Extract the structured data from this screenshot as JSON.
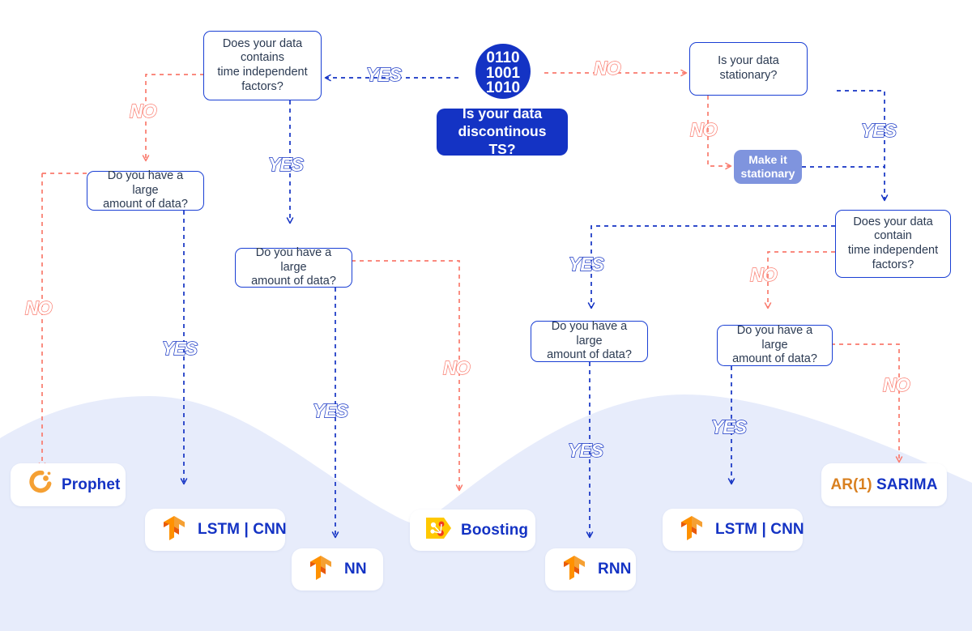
{
  "diagram": {
    "title": "Time series model selection flowchart",
    "colors": {
      "blue": "#1433c4",
      "coral": "#fa7a6d",
      "periwinkle": "#7f94de",
      "wave": "#e7ecfb",
      "orange": "#f5a033",
      "yellow": "#ffc801",
      "text": "#2b3a52"
    },
    "root": {
      "icon": "binary-circle-icon",
      "icon_rows": [
        "0110",
        "1001",
        "1010"
      ],
      "label": "Is your data\ndiscontinous TS?"
    },
    "decisions": [
      {
        "id": "d-left-factors",
        "label": "Does your data\ncontains\ntime independent\nfactors?"
      },
      {
        "id": "d-stationary",
        "label": "Is your data\nstationary?"
      },
      {
        "id": "d-right-factors",
        "label": "Does your data\ncontain\ntime independent\nfactors?"
      },
      {
        "id": "d-large-1",
        "label": "Do you have a large\namount of data?"
      },
      {
        "id": "d-large-2",
        "label": "Do you have a large\namount of data?"
      },
      {
        "id": "d-large-3",
        "label": "Do you have a large\namount of data?"
      },
      {
        "id": "d-large-4",
        "label": "Do you have a large\namount of data?"
      }
    ],
    "actions": [
      {
        "id": "a-make-stationary",
        "label": "Make it\nstationary"
      }
    ],
    "results": [
      {
        "id": "r-prophet",
        "icon": "prophet-logo-icon",
        "label": "Prophet"
      },
      {
        "id": "r-lstm-cnn-left",
        "icon": "tensorflow-logo-icon",
        "label": "LSTM | CNN"
      },
      {
        "id": "r-nn",
        "icon": "tensorflow-logo-icon",
        "label": "NN"
      },
      {
        "id": "r-boosting",
        "icon": "xgboost-logo-icon",
        "label": "Boosting"
      },
      {
        "id": "r-rnn",
        "icon": "tensorflow-logo-icon",
        "label": "RNN"
      },
      {
        "id": "r-lstm-cnn-right",
        "icon": "tensorflow-logo-icon",
        "label": "LSTM | CNN"
      },
      {
        "id": "r-arima",
        "icon": "none",
        "label_ar1": "AR(1)",
        "label_main": "SARIMA"
      }
    ],
    "edge_labels": [
      {
        "id": "e1",
        "text": "YES",
        "kind": "yes"
      },
      {
        "id": "e2",
        "text": "NO",
        "kind": "no"
      },
      {
        "id": "e3",
        "text": "NO",
        "kind": "no"
      },
      {
        "id": "e4",
        "text": "YES",
        "kind": "yes"
      },
      {
        "id": "e5",
        "text": "NO",
        "kind": "no"
      },
      {
        "id": "e6",
        "text": "YES",
        "kind": "yes"
      },
      {
        "id": "e7",
        "text": "NO",
        "kind": "no"
      },
      {
        "id": "e8",
        "text": "YES",
        "kind": "yes"
      },
      {
        "id": "e9",
        "text": "YES",
        "kind": "yes"
      },
      {
        "id": "e10",
        "text": "NO",
        "kind": "no"
      },
      {
        "id": "e11",
        "text": "YES",
        "kind": "yes"
      },
      {
        "id": "e12",
        "text": "NO",
        "kind": "no"
      },
      {
        "id": "e13",
        "text": "YES",
        "kind": "yes"
      },
      {
        "id": "e14",
        "text": "YES",
        "kind": "yes"
      },
      {
        "id": "e15",
        "text": "NO",
        "kind": "no"
      }
    ]
  }
}
